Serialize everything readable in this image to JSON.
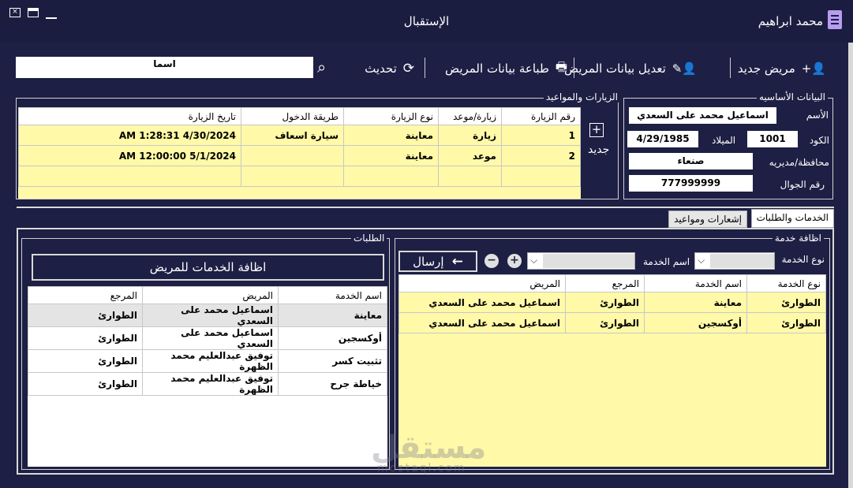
{
  "window": {
    "title": "الإستقبال",
    "user": "محمد ابراهيم"
  },
  "toolbar": {
    "new_patient": "مريض جديد",
    "edit_patient": "تعديل بيانات المريض",
    "print_patient": "طباعة بيانات المريض",
    "refresh": "تحديث",
    "search_value": "اسما"
  },
  "basic": {
    "legend": "البيانات الأساسيه",
    "name_label": "الأسم",
    "name_value": "اسماعيل محمد على السعدي",
    "code_label": "الكود",
    "code_value": "1001",
    "birth_label": "الميلاد",
    "birth_value": "4/29/1985",
    "gov_label": "محافظة/مديريه",
    "gov_value": "صنعاء",
    "phone_label": "رقم الجوال",
    "phone_value": "777999999"
  },
  "visits": {
    "legend": "الزيارات والمواعيد",
    "new_label": "جديد",
    "headers": [
      "رقم الزيارة",
      "زيارة/موعد",
      "نوع الزيارة",
      "طريقة الدخول",
      "تاريخ الزيارة"
    ],
    "rows": [
      [
        "1",
        "زيارة",
        "معاينة",
        "سيارة اسعاف",
        "4/30/2024 1:28:31 AM"
      ],
      [
        "2",
        "موعد",
        "معاينة",
        "",
        "5/1/2024 12:00:00 AM"
      ]
    ]
  },
  "tabs": {
    "services": "الخدمات والطلبات",
    "notifications": "إشعارات ومواعيد"
  },
  "add_service": {
    "legend": "اظافة خدمة",
    "type_label": "نوع الخدمة",
    "name_label": "اسم الخدمة",
    "send_label": "إرسال",
    "headers": [
      "نوع الخدمة",
      "اسم الخدمة",
      "المرجع",
      "المريض"
    ],
    "rows": [
      [
        "الطوارئ",
        "معاينة",
        "الطوارئ",
        "اسماعيل محمد على السعدي"
      ],
      [
        "الطوارئ",
        "أوكسجين",
        "الطوارئ",
        "اسماعيل محمد على السعدي"
      ]
    ]
  },
  "requests": {
    "legend": "الطلبات",
    "add_button": "اظافة الخدمات للمريض",
    "headers": [
      "اسم الخدمة",
      "المريض",
      "المرجع"
    ],
    "rows": [
      [
        "معاينة",
        "اسماعيل محمد على السعدي",
        "الطوارئ"
      ],
      [
        "أوكسجين",
        "اسماعيل محمد على السعدي",
        "الطوارئ"
      ],
      [
        "تثبيت كسر",
        "توفيق عبدالعليم محمد الظهرة",
        "الطوارئ"
      ],
      [
        "خياطة جرح",
        "توفيق عبدالعليم محمد الظهرة",
        "الطوارئ"
      ]
    ]
  },
  "watermark": {
    "text": "مستقل",
    "sub": "mostaql.com"
  }
}
